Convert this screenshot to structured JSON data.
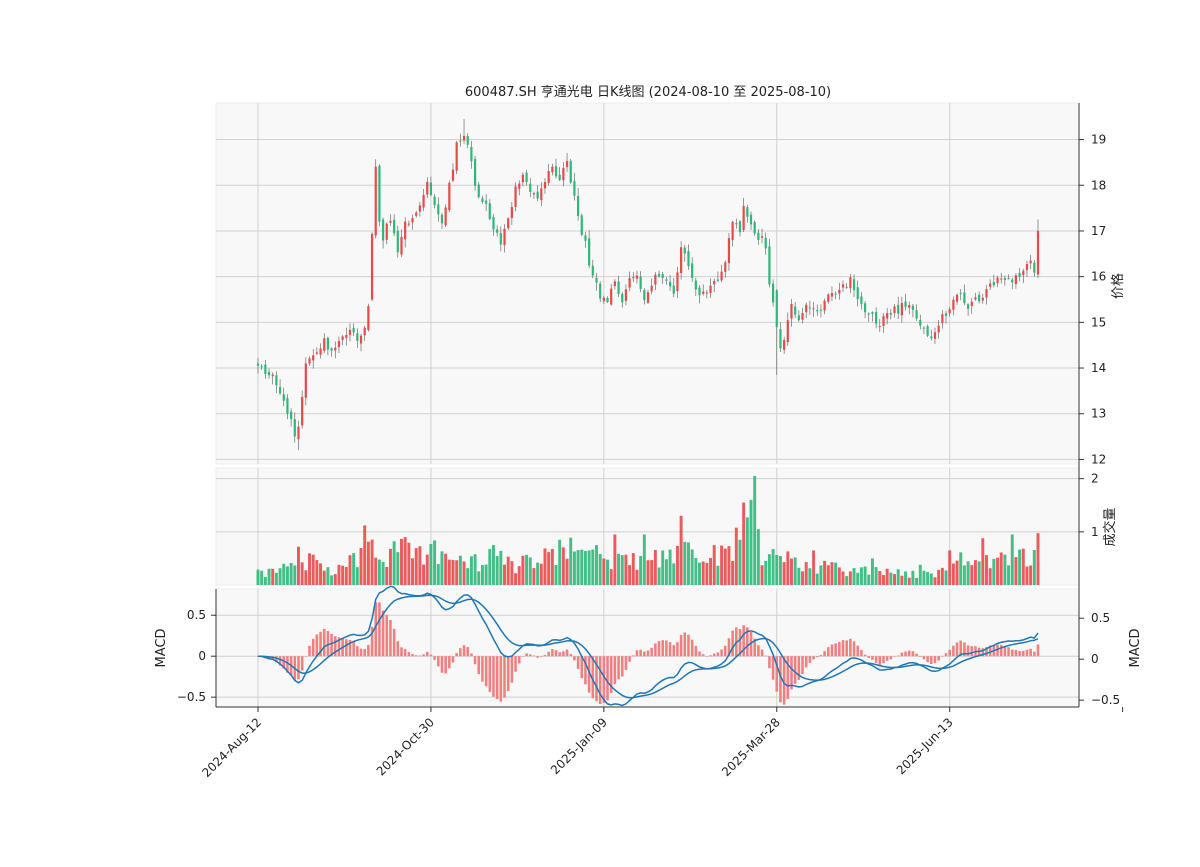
{
  "chart_data": {
    "type": "candlestick",
    "title": "600487.SH 亨通光电 日K线图 (2024-08-10 至 2025-08-10)",
    "colors": {
      "up": "#e84a4a",
      "down": "#2db87a",
      "macd_line": "#1f77b4",
      "panel_bg": "#f8f8f8",
      "grid": "#d0d0d0"
    },
    "x_tick_labels": [
      "2024-Aug-12",
      "2024-Oct-30",
      "2025-Jan-09",
      "2025-Mar-28",
      "2025-Jun-13"
    ],
    "price_panel": {
      "ylabel": "价格",
      "ylim": [
        11.9,
        19.8
      ],
      "yticks": [
        12,
        13,
        14,
        15,
        16,
        17,
        18,
        19
      ],
      "close_anchors": [
        [
          0,
          14.05
        ],
        [
          3,
          13.9
        ],
        [
          5,
          13.6
        ],
        [
          7,
          13.2
        ],
        [
          9,
          12.8
        ],
        [
          10,
          12.45
        ],
        [
          11,
          12.75
        ],
        [
          12,
          13.45
        ],
        [
          13,
          14.15
        ],
        [
          15,
          14.3
        ],
        [
          18,
          14.55
        ],
        [
          20,
          14.35
        ],
        [
          22,
          14.65
        ],
        [
          25,
          14.9
        ],
        [
          27,
          14.7
        ],
        [
          29,
          14.9
        ],
        [
          30,
          15.4
        ],
        [
          31,
          16.9
        ],
        [
          32,
          18.4
        ],
        [
          33,
          17.1
        ],
        [
          34,
          16.9
        ],
        [
          36,
          17.2
        ],
        [
          38,
          16.6
        ],
        [
          40,
          17.1
        ],
        [
          42,
          17.3
        ],
        [
          44,
          17.6
        ],
        [
          46,
          18.1
        ],
        [
          48,
          17.5
        ],
        [
          50,
          17.2
        ],
        [
          52,
          18.0
        ],
        [
          54,
          18.9
        ],
        [
          56,
          19.1
        ],
        [
          58,
          18.5
        ],
        [
          60,
          17.7
        ],
        [
          62,
          17.6
        ],
        [
          64,
          17.0
        ],
        [
          66,
          16.8
        ],
        [
          68,
          17.3
        ],
        [
          70,
          17.9
        ],
        [
          72,
          18.3
        ],
        [
          74,
          17.9
        ],
        [
          76,
          17.8
        ],
        [
          78,
          18.1
        ],
        [
          80,
          18.4
        ],
        [
          82,
          18.2
        ],
        [
          84,
          18.5
        ],
        [
          85,
          18.1
        ],
        [
          87,
          17.3
        ],
        [
          89,
          16.7
        ],
        [
          91,
          16.0
        ],
        [
          93,
          15.6
        ],
        [
          95,
          15.4
        ],
        [
          97,
          15.9
        ],
        [
          99,
          15.5
        ],
        [
          101,
          15.9
        ],
        [
          103,
          16.1
        ],
        [
          105,
          15.5
        ],
        [
          107,
          15.85
        ],
        [
          109,
          16.05
        ],
        [
          111,
          15.8
        ],
        [
          113,
          15.7
        ],
        [
          115,
          16.6
        ],
        [
          117,
          16.3
        ],
        [
          119,
          15.8
        ],
        [
          121,
          15.6
        ],
        [
          123,
          15.9
        ],
        [
          125,
          15.95
        ],
        [
          127,
          16.4
        ],
        [
          129,
          17.3
        ],
        [
          131,
          16.9
        ],
        [
          132,
          17.6
        ],
        [
          134,
          17.1
        ],
        [
          136,
          16.9
        ],
        [
          138,
          16.7
        ],
        [
          139,
          15.9
        ],
        [
          141,
          14.9
        ],
        [
          142,
          14.5
        ],
        [
          143,
          14.6
        ],
        [
          145,
          15.3
        ],
        [
          147,
          15.1
        ],
        [
          149,
          15.4
        ],
        [
          151,
          15.4
        ],
        [
          153,
          15.3
        ],
        [
          155,
          15.7
        ],
        [
          157,
          15.5
        ],
        [
          159,
          15.8
        ],
        [
          161,
          15.9
        ],
        [
          163,
          15.6
        ],
        [
          165,
          15.3
        ],
        [
          167,
          15.15
        ],
        [
          169,
          15.0
        ],
        [
          171,
          15.1
        ],
        [
          173,
          15.25
        ],
        [
          175,
          15.35
        ],
        [
          177,
          15.3
        ],
        [
          179,
          15.1
        ],
        [
          181,
          14.85
        ],
        [
          183,
          14.75
        ],
        [
          185,
          15.0
        ],
        [
          187,
          15.2
        ],
        [
          189,
          15.5
        ],
        [
          191,
          15.65
        ],
        [
          193,
          15.4
        ],
        [
          195,
          15.45
        ],
        [
          197,
          15.55
        ],
        [
          199,
          15.75
        ],
        [
          201,
          15.95
        ],
        [
          203,
          16.0
        ],
        [
          205,
          15.8
        ],
        [
          207,
          16.1
        ],
        [
          209,
          16.2
        ],
        [
          210,
          16.3
        ],
        [
          211,
          16.1
        ],
        [
          212,
          17.0
        ]
      ]
    },
    "volume_panel": {
      "ylabel": "成交量",
      "ylim": [
        0,
        2.2
      ],
      "yticks": [
        1,
        2
      ],
      "anchors": [
        [
          0,
          0.25
        ],
        [
          10,
          0.35
        ],
        [
          11,
          0.55
        ],
        [
          13,
          0.5
        ],
        [
          20,
          0.3
        ],
        [
          28,
          0.55
        ],
        [
          29,
          0.8
        ],
        [
          30,
          1.05
        ],
        [
          31,
          0.95
        ],
        [
          34,
          0.5
        ],
        [
          38,
          0.85
        ],
        [
          40,
          0.75
        ],
        [
          44,
          0.6
        ],
        [
          48,
          0.7
        ],
        [
          52,
          0.55
        ],
        [
          55,
          0.45
        ],
        [
          58,
          0.5
        ],
        [
          60,
          0.45
        ],
        [
          63,
          0.55
        ],
        [
          66,
          0.5
        ],
        [
          70,
          0.4
        ],
        [
          75,
          0.5
        ],
        [
          80,
          0.55
        ],
        [
          84,
          0.7
        ],
        [
          88,
          0.65
        ],
        [
          92,
          0.55
        ],
        [
          95,
          0.5
        ],
        [
          98,
          0.6
        ],
        [
          100,
          0.55
        ],
        [
          104,
          0.5
        ],
        [
          108,
          0.55
        ],
        [
          112,
          0.6
        ],
        [
          116,
          0.65
        ],
        [
          120,
          0.6
        ],
        [
          124,
          0.55
        ],
        [
          128,
          0.65
        ],
        [
          130,
          0.85
        ],
        [
          132,
          1.3
        ],
        [
          133,
          1.2
        ],
        [
          135,
          0.7
        ],
        [
          140,
          0.55
        ],
        [
          145,
          0.5
        ],
        [
          150,
          0.4
        ],
        [
          155,
          0.35
        ],
        [
          160,
          0.3
        ],
        [
          165,
          0.28
        ],
        [
          170,
          0.26
        ],
        [
          175,
          0.25
        ],
        [
          180,
          0.22
        ],
        [
          185,
          0.25
        ],
        [
          188,
          0.3
        ],
        [
          190,
          0.45
        ],
        [
          192,
          0.6
        ],
        [
          194,
          0.5
        ],
        [
          198,
          0.45
        ],
        [
          200,
          0.5
        ],
        [
          203,
          0.55
        ],
        [
          205,
          0.75
        ],
        [
          207,
          0.6
        ],
        [
          209,
          0.5
        ],
        [
          211,
          0.55
        ],
        [
          212,
          1.7
        ]
      ],
      "spikes": [
        [
          8,
          0.35
        ],
        [
          11,
          0.72
        ],
        [
          26,
          0.6
        ],
        [
          29,
          1.12
        ],
        [
          40,
          0.9
        ],
        [
          64,
          0.75
        ],
        [
          72,
          0.55
        ],
        [
          82,
          0.85
        ],
        [
          92,
          0.75
        ],
        [
          97,
          0.95
        ],
        [
          105,
          0.95
        ],
        [
          110,
          0.65
        ],
        [
          115,
          1.3
        ],
        [
          117,
          0.8
        ],
        [
          124,
          0.75
        ],
        [
          131,
          0.85
        ],
        [
          132,
          1.55
        ],
        [
          134,
          1.6
        ],
        [
          135,
          2.05
        ],
        [
          136,
          1.05
        ],
        [
          151,
          0.65
        ],
        [
          167,
          0.5
        ],
        [
          180,
          0.38
        ],
        [
          188,
          0.65
        ],
        [
          197,
          0.88
        ],
        [
          205,
          0.95
        ]
      ]
    },
    "macd_panel": {
      "ylabel": "MACD",
      "ylim": [
        -0.62,
        0.82
      ],
      "yticks": [
        -0.5,
        0,
        0.5
      ]
    }
  }
}
